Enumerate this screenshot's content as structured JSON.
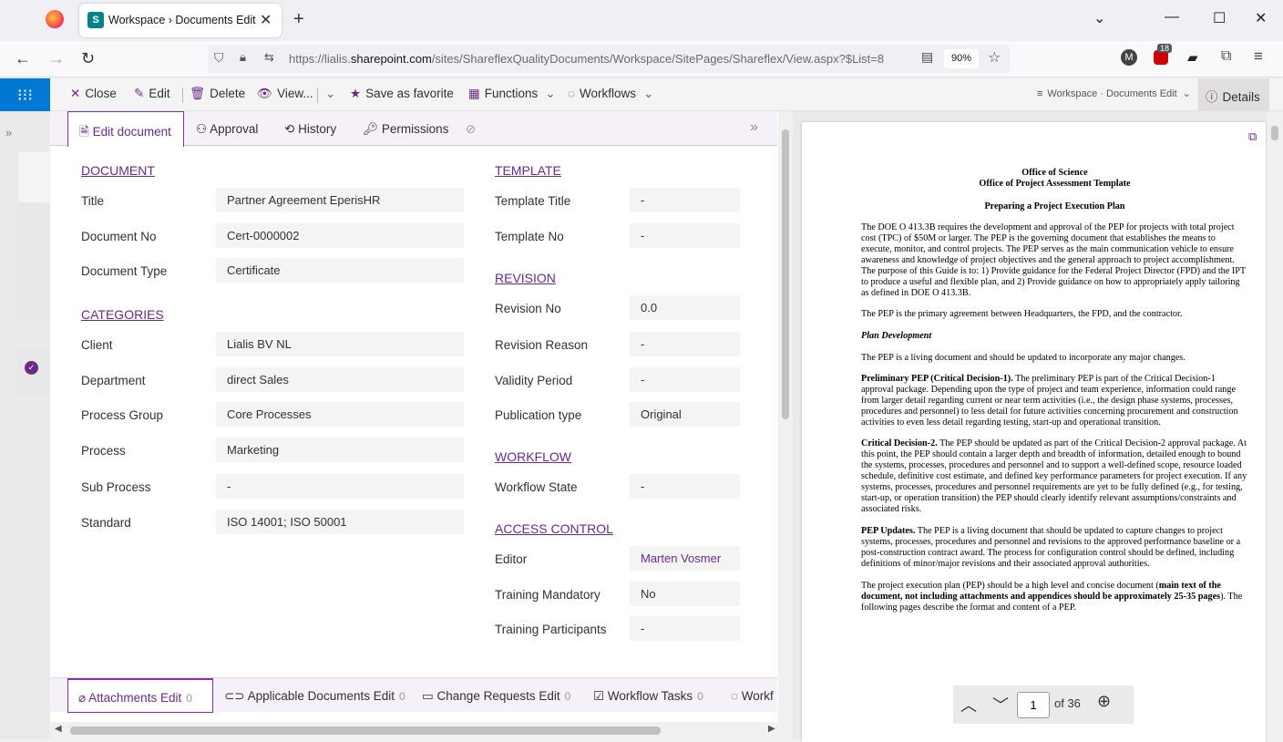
{
  "browser": {
    "tab_title": "Workspace › Documents Edit",
    "url_prefix": "https://lialis.",
    "url_domain": "sharepoint.com",
    "url_rest": "/sites/ShareflexQualityDocuments/Workspace/SitePages/Shareflex/View.aspx?$List=8",
    "zoom": "90%",
    "badge_count": "18"
  },
  "commandbar": {
    "close": "Close",
    "edit": "Edit",
    "delete": "Delete",
    "view": "View...",
    "favorite": "Save as favorite",
    "functions": "Functions",
    "workflows": "Workflows",
    "breadcrumb": "Workspace · Documents Edit",
    "details": "Details"
  },
  "tabs": [
    "Edit document",
    "Approval",
    "History",
    "Permissions"
  ],
  "left": {
    "document_heading": "DOCUMENT",
    "title_label": "Title",
    "title_value": "Partner Agreement EperisHR",
    "docno_label": "Document No",
    "docno_value": "Cert-0000002",
    "doctype_label": "Document Type",
    "doctype_value": "Certificate",
    "categories_heading": "CATEGORIES",
    "client_label": "Client",
    "client_value": "Lialis BV NL",
    "department_label": "Department",
    "department_value": "direct Sales",
    "processgroup_label": "Process Group",
    "processgroup_value": "Core Processes",
    "process_label": "Process",
    "process_value": "Marketing",
    "subprocess_label": "Sub Process",
    "subprocess_value": "-",
    "standard_label": "Standard",
    "standard_value": "ISO 14001; ISO 50001"
  },
  "right": {
    "template_heading": "TEMPLATE",
    "templatetitle_label": "Template Title",
    "templatetitle_value": "-",
    "templateno_label": "Template No",
    "templateno_value": "-",
    "revision_heading": "REVISION",
    "revno_label": "Revision No",
    "revno_value": "0.0",
    "revreason_label": "Revision Reason",
    "revreason_value": "-",
    "validity_label": "Validity Period",
    "validity_value": "-",
    "pubtype_label": "Publication type",
    "pubtype_value": "Original",
    "workflow_heading": "WORKFLOW",
    "wfstate_label": "Workflow State",
    "wfstate_value": "-",
    "access_heading": "ACCESS CONTROL",
    "editor_label": "Editor",
    "editor_value": "Marten Vosmer",
    "trainmand_label": "Training Mandatory",
    "trainmand_value": "No",
    "trainpart_label": "Training Participants",
    "trainpart_value": "-"
  },
  "bottom_tabs": [
    {
      "label": "Attachments Edit",
      "count": "0"
    },
    {
      "label": "Applicable Documents Edit",
      "count": "0"
    },
    {
      "label": "Change Requests Edit",
      "count": "0"
    },
    {
      "label": "Workflow Tasks",
      "count": "0"
    },
    {
      "label": "Workf",
      "count": ""
    }
  ],
  "preview": {
    "h1": "Office of Science",
    "h2": "Office of Project Assessment Template",
    "h3": "Preparing a Project Execution Plan",
    "p1": "The DOE O 413.3B requires the development and approval of the PEP for projects with total project cost (TPC) of $50M or larger. The PEP is the governing document that establishes the means to execute, monitor, and control projects. The PEP serves as the main communication vehicle to ensure awareness and knowledge of project objectives and the general approach to project accomplishment. The purpose of this Guide is to: 1) Provide guidance for the Federal Project Director (FPD) and the IPT to produce a useful and flexible plan, and 2) Provide guidance on how to appropriately apply tailoring as defined in DOE O 413.3B.",
    "p2": "The PEP is the primary agreement between Headquarters, the FPD, and the contractor.",
    "p3": "Plan Development",
    "p4": "The PEP is a living document and should be updated to incorporate any major changes.",
    "p5_bold": "Preliminary PEP (Critical Decision-1).",
    "p5": " The preliminary PEP is part of the Critical Decision-1 approval package. Depending upon the type of project and team experience, information could range from larger detail regarding current or near term activities (i.e., the design phase systems, processes, procedures and personnel) to less detail for future activities concerning procurement and construction activities to even less detail regarding testing, start-up and operational transition.",
    "p6_bold": "Critical Decision-2.",
    "p6": " The PEP should be updated as part of the Critical Decision-2 approval package. At this point, the PEP should contain a larger depth and breadth of information, detailed enough to bound the systems, processes, procedures and personnel and to support a well-defined scope, resource loaded schedule, definitive cost estimate, and defined key performance parameters for project execution. If any systems, processes, procedures and personnel requirements are yet to be fully defined (e.g., for testing, start-up, or operation transition) the PEP should clearly identify relevant assumptions/constraints and associated risks.",
    "p7_bold": "PEP Updates.",
    "p7": " The PEP is a living document that should be updated to capture changes to project systems, processes, procedures and personnel and revisions to the approved performance baseline or a post-construction contract award. The process for configuration control should be defined, including definitions of minor/major revisions and their associated approval authorities.",
    "p8a": "The project execution plan (PEP) should be a high level and concise document (",
    "p8_bold": "main text of the document, not including attachments and appendices should be approximately 25-35 pages",
    "p8b": "). The following pages describe the format and content of a PEP.",
    "page_current": "1",
    "page_total": "of 36"
  }
}
